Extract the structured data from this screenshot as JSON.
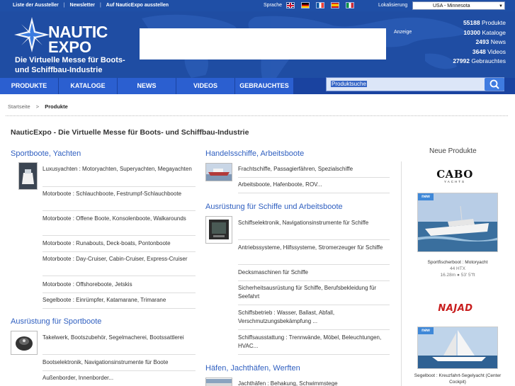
{
  "topbar": {
    "links": [
      "Liste der Aussteller",
      "Newsletter",
      "Auf NauticExpo ausstellen"
    ],
    "sprache_label": "Sprache",
    "lokalisierung_label": "Lokalisierung",
    "location_value": "USA - Minnesota"
  },
  "header": {
    "logo_line1": "NAUTIC",
    "logo_line2": "EXPO",
    "tagline": "Die Virtuelle Messe für Boots- und Schiffbau-Industrie",
    "anzeige": "Anzeige",
    "stats": [
      {
        "num": "55188",
        "label": "Produkte"
      },
      {
        "num": "10300",
        "label": "Kataloge"
      },
      {
        "num": "2493",
        "label": "News"
      },
      {
        "num": "3648",
        "label": "Videos"
      },
      {
        "num": "27992",
        "label": "Gebrauchtes"
      }
    ]
  },
  "nav": {
    "tabs": [
      "PRODUKTE",
      "KATALOGE",
      "NEWS",
      "VIDEOS",
      "GEBRAUCHTES"
    ],
    "search_placeholder": "Produktsuche"
  },
  "breadcrumb": {
    "home": "Startseite",
    "sep": ">",
    "current": "Produkte"
  },
  "page_title": "NauticExpo - Die Virtuelle Messe für Boots- und Schiffbau-Industrie",
  "left_categories": [
    {
      "title": "Sportboote, Yachten",
      "items": [
        "Luxusyachten : Motoryachten, Superyachten, Megayachten",
        "Motorboote : Schlauchboote, Festrumpf-Schlauchboote",
        "Motorboote : Offene Boote, Konsolenboote, Walkarounds",
        "Motorboote : Runabouts, Deck-boats, Pontonboote",
        "Motorboote : Day-Cruiser, Cabin-Cruiser, Express-Cruiser",
        "Motorboote : Offshoreboote, Jetskis",
        "Segelboote : Einrümpfer, Katamarane, Trimarane"
      ]
    },
    {
      "title": "Ausrüstung für Sportboote",
      "items": [
        "Takelwerk, Bootszubehör, Segelmacherei, Bootssattlerei",
        "Bootselektronik, Navigationsinstrumente für Boote",
        "Außenborder, Innenborder..."
      ]
    }
  ],
  "right_categories": [
    {
      "title": "Handelsschiffe, Arbeitsboote",
      "items": [
        "Frachtschiffe, Passagierfähren, Spezialschiffe",
        "Arbeitsboote, Hafenboote, ROV..."
      ]
    },
    {
      "title": "Ausrüstung für Schiffe und Arbeitsboote",
      "items": [
        "Schiffselektronik, Navigationsinstrumente für Schiffe",
        "Antriebssysteme, Hilfssysteme, Stromerzeuger für Schiffe",
        "Decksmaschinen für Schiffe",
        "Sicherheitsausrüstung für Schiffe, Berufsbekleidung für Seefahrt",
        "Schiffsbetrieb : Wasser, Ballast, Abfall, Verschmutzungsbekämpfung ...",
        "Schiffsausstattung : Trennwände, Möbel, Beleuchtungen, HVAC..."
      ]
    },
    {
      "title": "Häfen, Jachthäfen, Werften",
      "items": [
        "Jachthäfen : Behakung, Schwimmstege"
      ]
    }
  ],
  "sidebar": {
    "title": "Neue Produkte",
    "products": [
      {
        "brand": "CABO",
        "brand_sub": "YACHTS",
        "badge": "new",
        "caption": "Sportfischerboot : Motoryacht",
        "sub1": "44 HTX",
        "sub2": "16.28m ● 53' 5\"ft"
      },
      {
        "brand": "NAJAD",
        "badge": "new",
        "caption": "Segelboot : Kreuzfahrt-Segelyacht (Center Cockpit)"
      }
    ]
  }
}
